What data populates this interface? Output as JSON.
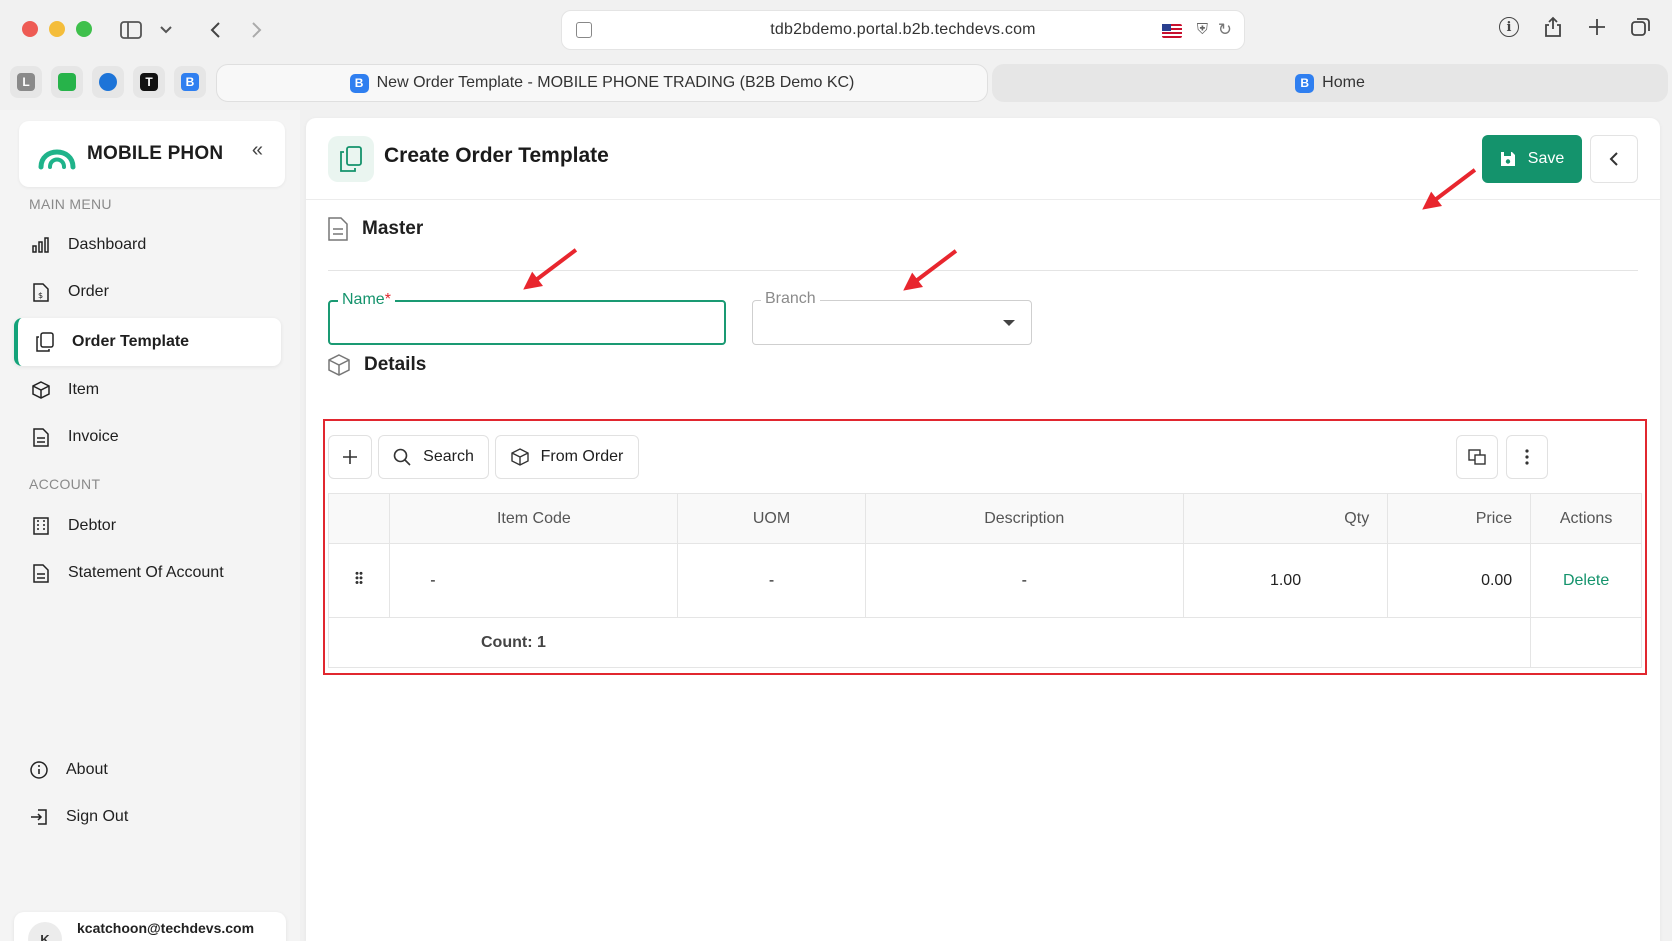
{
  "browser": {
    "url": "tdb2bdemo.portal.b2b.techdevs.com",
    "pinned_tabs": [
      {
        "letter": "L",
        "color": "#8a8a8a"
      },
      {
        "letter": "",
        "color": "#27b34a"
      },
      {
        "letter": "",
        "color": "#1d74d8"
      },
      {
        "letter": "T",
        "color": "#111111"
      },
      {
        "letter": "B",
        "color": "#2f7ff0"
      }
    ],
    "tabs": [
      {
        "favicon": "B",
        "label": "New Order Template - MOBILE PHONE TRADING (B2B Demo KC)",
        "active": true
      },
      {
        "favicon": "B",
        "label": "Home",
        "active": false
      }
    ]
  },
  "sidebar": {
    "brand_name": "MOBILE PHON",
    "main_menu_label": "MAIN MENU",
    "main_items": [
      {
        "label": "Dashboard",
        "icon": "bar-chart-icon"
      },
      {
        "label": "Order",
        "icon": "order-icon"
      },
      {
        "label": "Order Template",
        "icon": "copy-icon",
        "active": true
      },
      {
        "label": "Item",
        "icon": "box-icon"
      },
      {
        "label": "Invoice",
        "icon": "invoice-icon"
      }
    ],
    "account_label": "ACCOUNT",
    "account_items": [
      {
        "label": "Debtor",
        "icon": "building-icon"
      },
      {
        "label": "Statement Of Account",
        "icon": "document-icon"
      }
    ],
    "bottom_items": [
      {
        "label": "About",
        "icon": "info-icon"
      },
      {
        "label": "Sign Out",
        "icon": "sign-out-icon"
      }
    ],
    "user": {
      "initial": "K",
      "email": "kcatchoon@techdevs.com"
    }
  },
  "page": {
    "title": "Create Order Template",
    "save_label": "Save",
    "master_title": "Master",
    "name_label": "Name",
    "name_required_mark": "*",
    "name_value": "",
    "branch_label": "Branch",
    "branch_value": "",
    "details_title": "Details",
    "search_label": "Search",
    "from_order_label": "From Order"
  },
  "table": {
    "columns": [
      "Item Code",
      "UOM",
      "Description",
      "Qty",
      "Price",
      "Actions"
    ],
    "rows": [
      {
        "item_code": "-",
        "uom": "-",
        "description": "-",
        "qty": "1.00",
        "price": "0.00",
        "action": "Delete"
      }
    ],
    "count_text": "Count: 1"
  },
  "colors": {
    "accent": "#14936c",
    "annotation": "#e8262e"
  }
}
